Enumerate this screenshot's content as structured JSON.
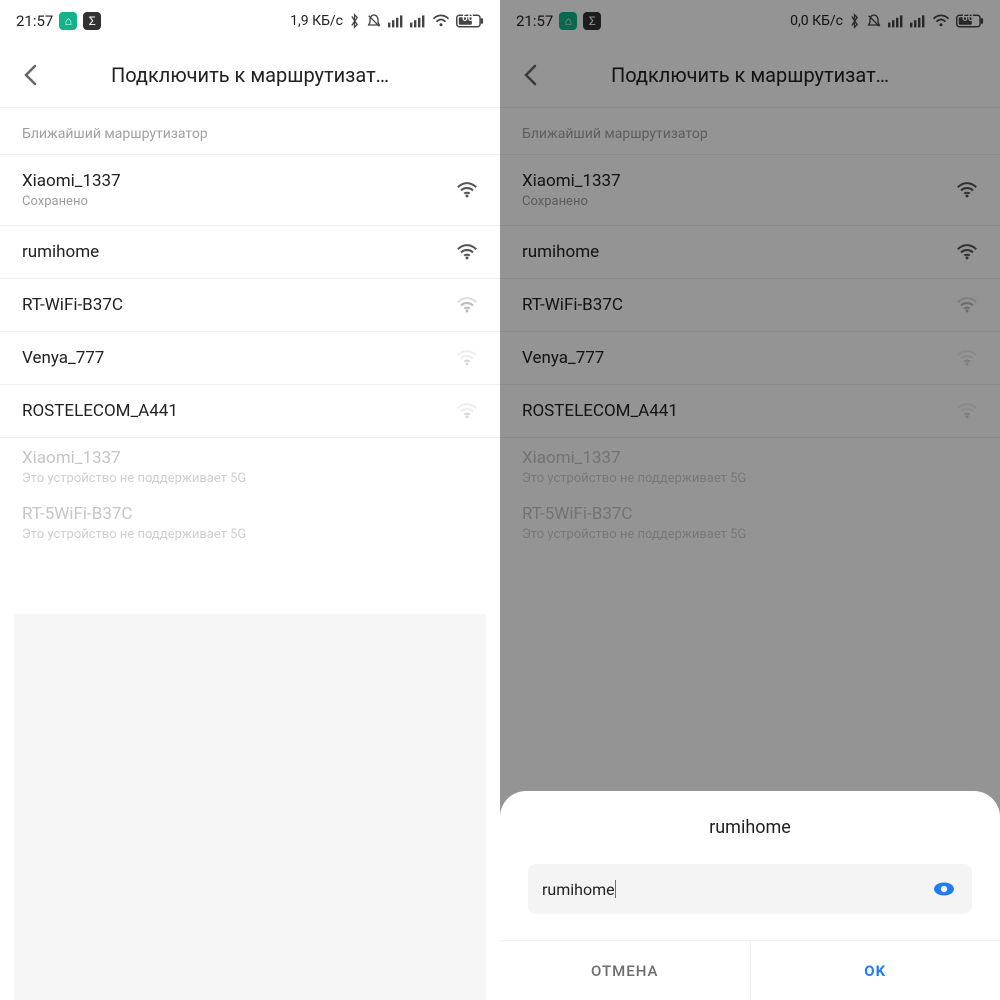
{
  "left": {
    "status": {
      "time": "21:57",
      "data_rate": "1,9 КБ/с",
      "battery": "60"
    },
    "title": "Подключить к маршрутизат…",
    "section": "Ближайший маршрутизатор",
    "rows": [
      {
        "name": "Xiaomi_1337",
        "sub": "Сохранено",
        "strength": "full"
      },
      {
        "name": "rumihome",
        "strength": "full"
      },
      {
        "name": "RT-WiFi-B37C",
        "strength": "weak"
      },
      {
        "name": "Venya_777",
        "strength": "very-weak"
      },
      {
        "name": "ROSTELECOM_A441",
        "strength": "very-weak"
      },
      {
        "name": "Xiaomi_1337",
        "sub": "Это устройство не поддерживает 5G",
        "disabled": true
      },
      {
        "name": "RT-5WiFi-B37C",
        "sub": "Это устройство не поддерживает 5G",
        "disabled": true
      }
    ]
  },
  "right": {
    "status": {
      "time": "21:57",
      "data_rate": "0,0 КБ/с",
      "battery": "60"
    },
    "title": "Подключить к маршрутизат…",
    "section": "Ближайший маршрутизатор",
    "rows": [
      {
        "name": "Xiaomi_1337",
        "sub": "Сохранено",
        "strength": "full"
      },
      {
        "name": "rumihome",
        "strength": "full"
      },
      {
        "name": "RT-WiFi-B37C",
        "strength": "weak"
      },
      {
        "name": "Venya_777",
        "strength": "very-weak"
      },
      {
        "name": "ROSTELECOM_A441",
        "strength": "very-weak"
      },
      {
        "name": "Xiaomi_1337",
        "sub": "Это устройство не поддерживает 5G",
        "disabled": true
      },
      {
        "name": "RT-5WiFi-B37C",
        "sub": "Это устройство не поддерживает 5G",
        "disabled": true
      }
    ],
    "dialog": {
      "title": "rumihome",
      "input_value": "rumihome",
      "cancel": "ОТМЕНА",
      "ok": "OK"
    }
  }
}
